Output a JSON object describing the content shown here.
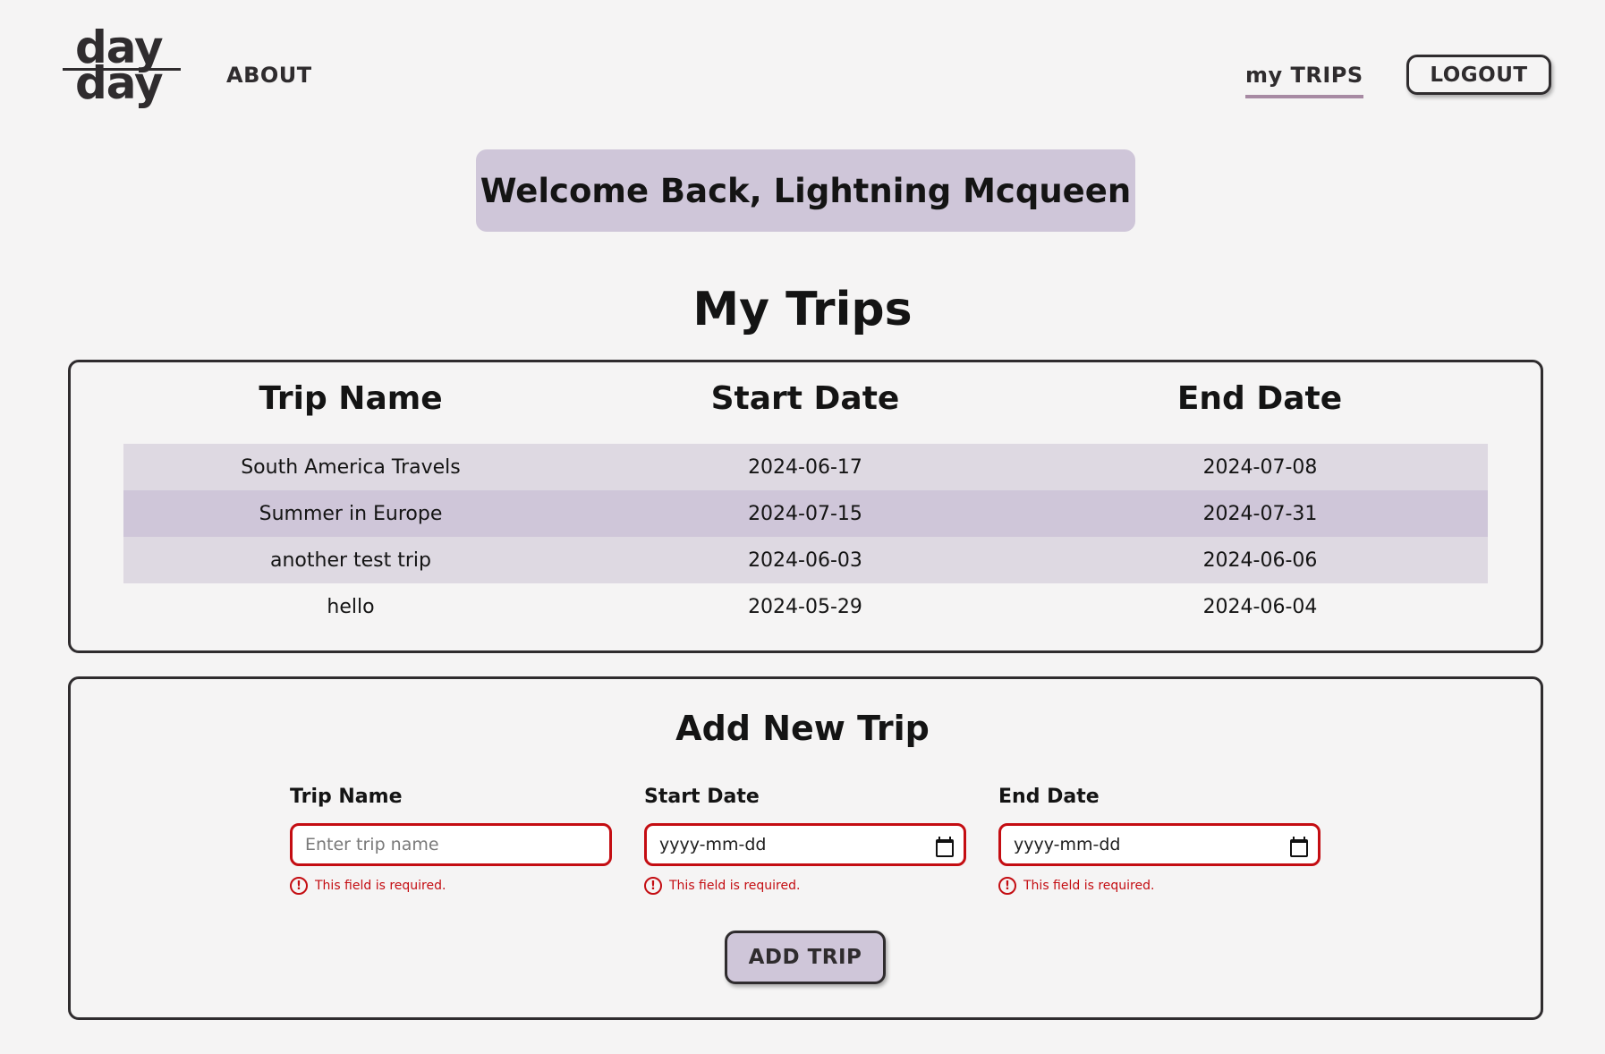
{
  "header": {
    "logo_line1": "day",
    "logo_line2": "day",
    "nav_about": "ABOUT",
    "nav_my_trips": "my TRIPS",
    "logout_label": "LOGOUT"
  },
  "welcome": {
    "text": "Welcome Back, Lightning Mcqueen"
  },
  "trips": {
    "title": "My Trips",
    "columns": [
      "Trip Name",
      "Start Date",
      "End Date"
    ],
    "rows": [
      [
        "South America Travels",
        "2024-06-17",
        "2024-07-08"
      ],
      [
        "Summer in Europe",
        "2024-07-15",
        "2024-07-31"
      ],
      [
        "another test trip",
        "2024-06-03",
        "2024-06-06"
      ],
      [
        "hello",
        "2024-05-29",
        "2024-06-04"
      ]
    ]
  },
  "add_trip": {
    "title": "Add New Trip",
    "fields": [
      {
        "label": "Trip Name",
        "placeholder": "Enter trip name",
        "value": "",
        "error": "This field is required."
      },
      {
        "label": "Start Date",
        "placeholder": "",
        "value": "yyyy-mm-dd",
        "error": "This field is required."
      },
      {
        "label": "End Date",
        "placeholder": "",
        "value": "yyyy-mm-dd",
        "error": "This field is required."
      }
    ],
    "submit_label": "ADD TRIP",
    "error_icon_glyph": "!"
  },
  "colors": {
    "accent_lavender": "#cfc6d9",
    "row_light": "#ded9e2",
    "nav_underline": "#a78aa3",
    "error_red": "#c40d12",
    "border_dark": "#2f2c2e",
    "background": "#f5f4f4"
  },
  "icons": {
    "date_picker": "calendar-icon",
    "error": "error-circle-icon"
  }
}
